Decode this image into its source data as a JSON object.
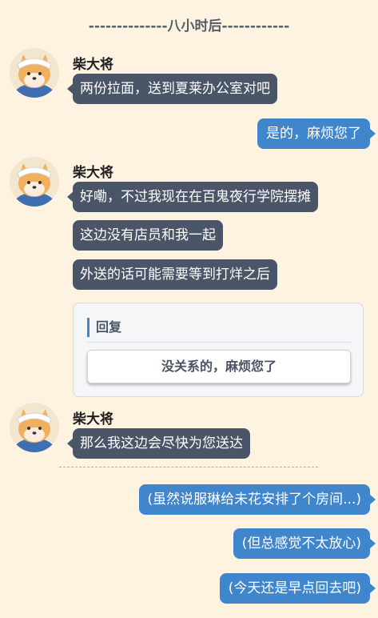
{
  "time_divider": "--------------八小时后------------",
  "character_name": "柴大将",
  "messages": {
    "m1": "两份拉面，送到夏莱办公室对吧",
    "r1": "是的，麻烦您了",
    "m2": "好嘞，不过我现在在百鬼夜行学院摆摊",
    "m3": "这边没有店员和我一起",
    "m4": "外送的话可能需要等到打烊之后",
    "m5": "那么我这边会尽快为您送达",
    "r2": "(虽然说服琳给未花安排了个房间...)",
    "r3": "(但总感觉不太放心)",
    "r4": "(今天还是早点回去吧)"
  },
  "reply": {
    "label": "回复",
    "option": "没关系的，麻烦您了"
  },
  "colors": {
    "background": "#fdf3e0",
    "npc_bubble": "#4b5568",
    "player_bubble": "#3f86cc"
  }
}
